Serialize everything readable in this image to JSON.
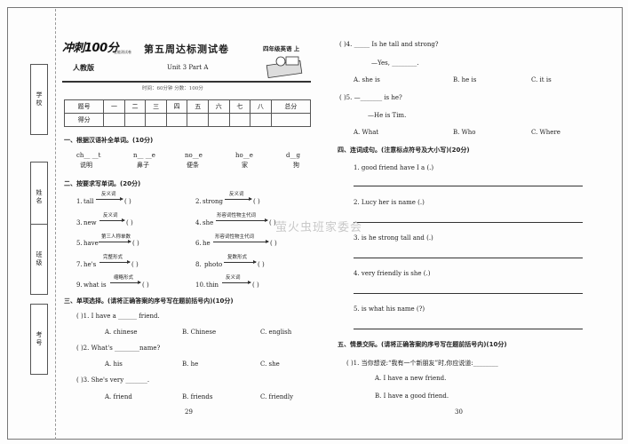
{
  "sidebar": {
    "labels": [
      "学校",
      "姓名",
      "班级",
      "考号"
    ]
  },
  "header": {
    "logo": "冲刺100分",
    "logo_sub": "全能测试卷",
    "title": "第五周达标测试卷",
    "grade": "四年级英语 上",
    "edition": "人教版",
    "unit": "Unit 3   Part A",
    "time": "时间：60分钟   分数：100分"
  },
  "score_table": {
    "row1": [
      "题号",
      "一",
      "二",
      "三",
      "四",
      "五",
      "六",
      "七",
      "八",
      "总分"
    ],
    "row2": [
      "得分",
      "",
      "",
      "",
      "",
      "",
      "",
      "",
      "",
      ""
    ]
  },
  "section1": {
    "title": "一、根据汉语补全单词。(10分)",
    "items": [
      {
        "word": "ch__ __t",
        "cn": "说明"
      },
      {
        "word": "n__ __e",
        "cn": "鼻子"
      },
      {
        "word": "no__e",
        "cn": "便条"
      },
      {
        "word": "ho__e",
        "cn": "家"
      },
      {
        "word": "d__g",
        "cn": "狗"
      }
    ]
  },
  "section2": {
    "title": "二、按要求写单词。(20分)",
    "items": [
      {
        "num": "1.",
        "word": "tall",
        "hint": "反义词",
        "paren": "(    )"
      },
      {
        "num": "2.",
        "word": "strong",
        "hint": "反义词",
        "paren": "(    )"
      },
      {
        "num": "3.",
        "word": "new",
        "hint": "反义词",
        "paren": "(    )"
      },
      {
        "num": "4.",
        "word": "she",
        "hint": "形容词性物主代词",
        "paren": "(    )"
      },
      {
        "num": "5.",
        "word": "have",
        "hint": "第三人称单数",
        "paren": "(    )"
      },
      {
        "num": "6.",
        "word": "he",
        "hint": "形容词性物主代词",
        "paren": "(    )"
      },
      {
        "num": "7.",
        "word": "he's",
        "hint": "完整形式",
        "paren": "(    )"
      },
      {
        "num": "8.",
        "word": "photo",
        "hint": "复数形式",
        "paren": "(    )"
      },
      {
        "num": "9.",
        "word": "what is",
        "hint": "缩略形式",
        "paren": "(    )"
      },
      {
        "num": "10.",
        "word": "thin",
        "hint": "反义词",
        "paren": "(    )"
      }
    ]
  },
  "section3": {
    "title": "三、单项选择。(请将正确答案的序号写在题前括号内)(10分)",
    "q1": {
      "stem": "(      )1. I have a ______ friend.",
      "a": "A. chinese",
      "b": "B. Chinese",
      "c": "C. english"
    },
    "q2": {
      "stem": "(      )2. What's ________name?",
      "a": "A. his",
      "b": "B. he",
      "c": "C. she"
    },
    "q3": {
      "stem": "(      )3. She's very _______.",
      "a": "A. friend",
      "b": "B. friends",
      "c": "C. friendly"
    },
    "q4": {
      "stem": "(      )4.  _____ Is he tall and strong?",
      "reply": "—Yes, ________.",
      "a": "A. she is",
      "b": "B. he is",
      "c": "C. it is"
    },
    "q5": {
      "stem": "(      )5. —_______ is he?",
      "reply": "—He is Tim.",
      "a": "A. What",
      "b": "B. Who",
      "c": "C. Where"
    }
  },
  "section4": {
    "title": "四、连词成句。(注意标点符号及大小写)(20分)",
    "items": [
      "1. good   friend   have   I   a  (.)",
      "2. Lucy   her   is   name  (.)",
      "3. is   he   strong   tall   and  (.)",
      "4. very   friendly   is   she  (.)",
      "5. is   what   his   name  (?)"
    ]
  },
  "section5": {
    "title": "五、情景交际。(请将正确答案的序号写在题前括号内)(10分)",
    "q1": "(      )1. 当你想说:“我有一个新朋友”时,你应说道:________",
    "a": "A. I have a new friend.",
    "b": "B. I have a good friend."
  },
  "page_numbers": {
    "left": "29",
    "right": "30"
  },
  "watermark": "萤火虫班家委会"
}
